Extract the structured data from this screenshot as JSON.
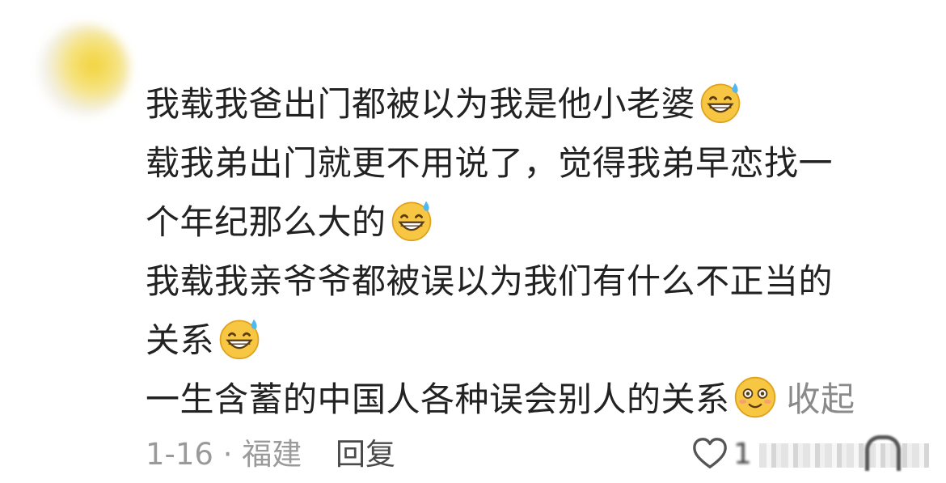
{
  "comment": {
    "lines": [
      "我载我爸出门都被以为我是他小老婆",
      "载我弟出门就更不用说了，觉得我弟早恋找一",
      "个年纪那么大的",
      "我载我亲爷爷都被误以为我们有什么不正当的",
      "关系",
      "一生含蓄的中国人各种误会别人的关系"
    ],
    "collapse_label": "收起"
  },
  "meta": {
    "date_location": "1-16 · 福建",
    "reply_label": "回复"
  },
  "actions": {
    "like_count": "1"
  },
  "icons": {
    "avatar": "avatar",
    "emoji_1": "grinning-sweat-emoji",
    "emoji_2": "grinning-sweat-emoji",
    "emoji_3": "grinning-sweat-emoji",
    "emoji_4": "flushed-smile-emoji",
    "like": "heart-icon"
  },
  "colors": {
    "text": "#222222",
    "muted": "#9a9a9a",
    "collapse": "#8a8a8a",
    "emoji_face": "#f7c744"
  }
}
